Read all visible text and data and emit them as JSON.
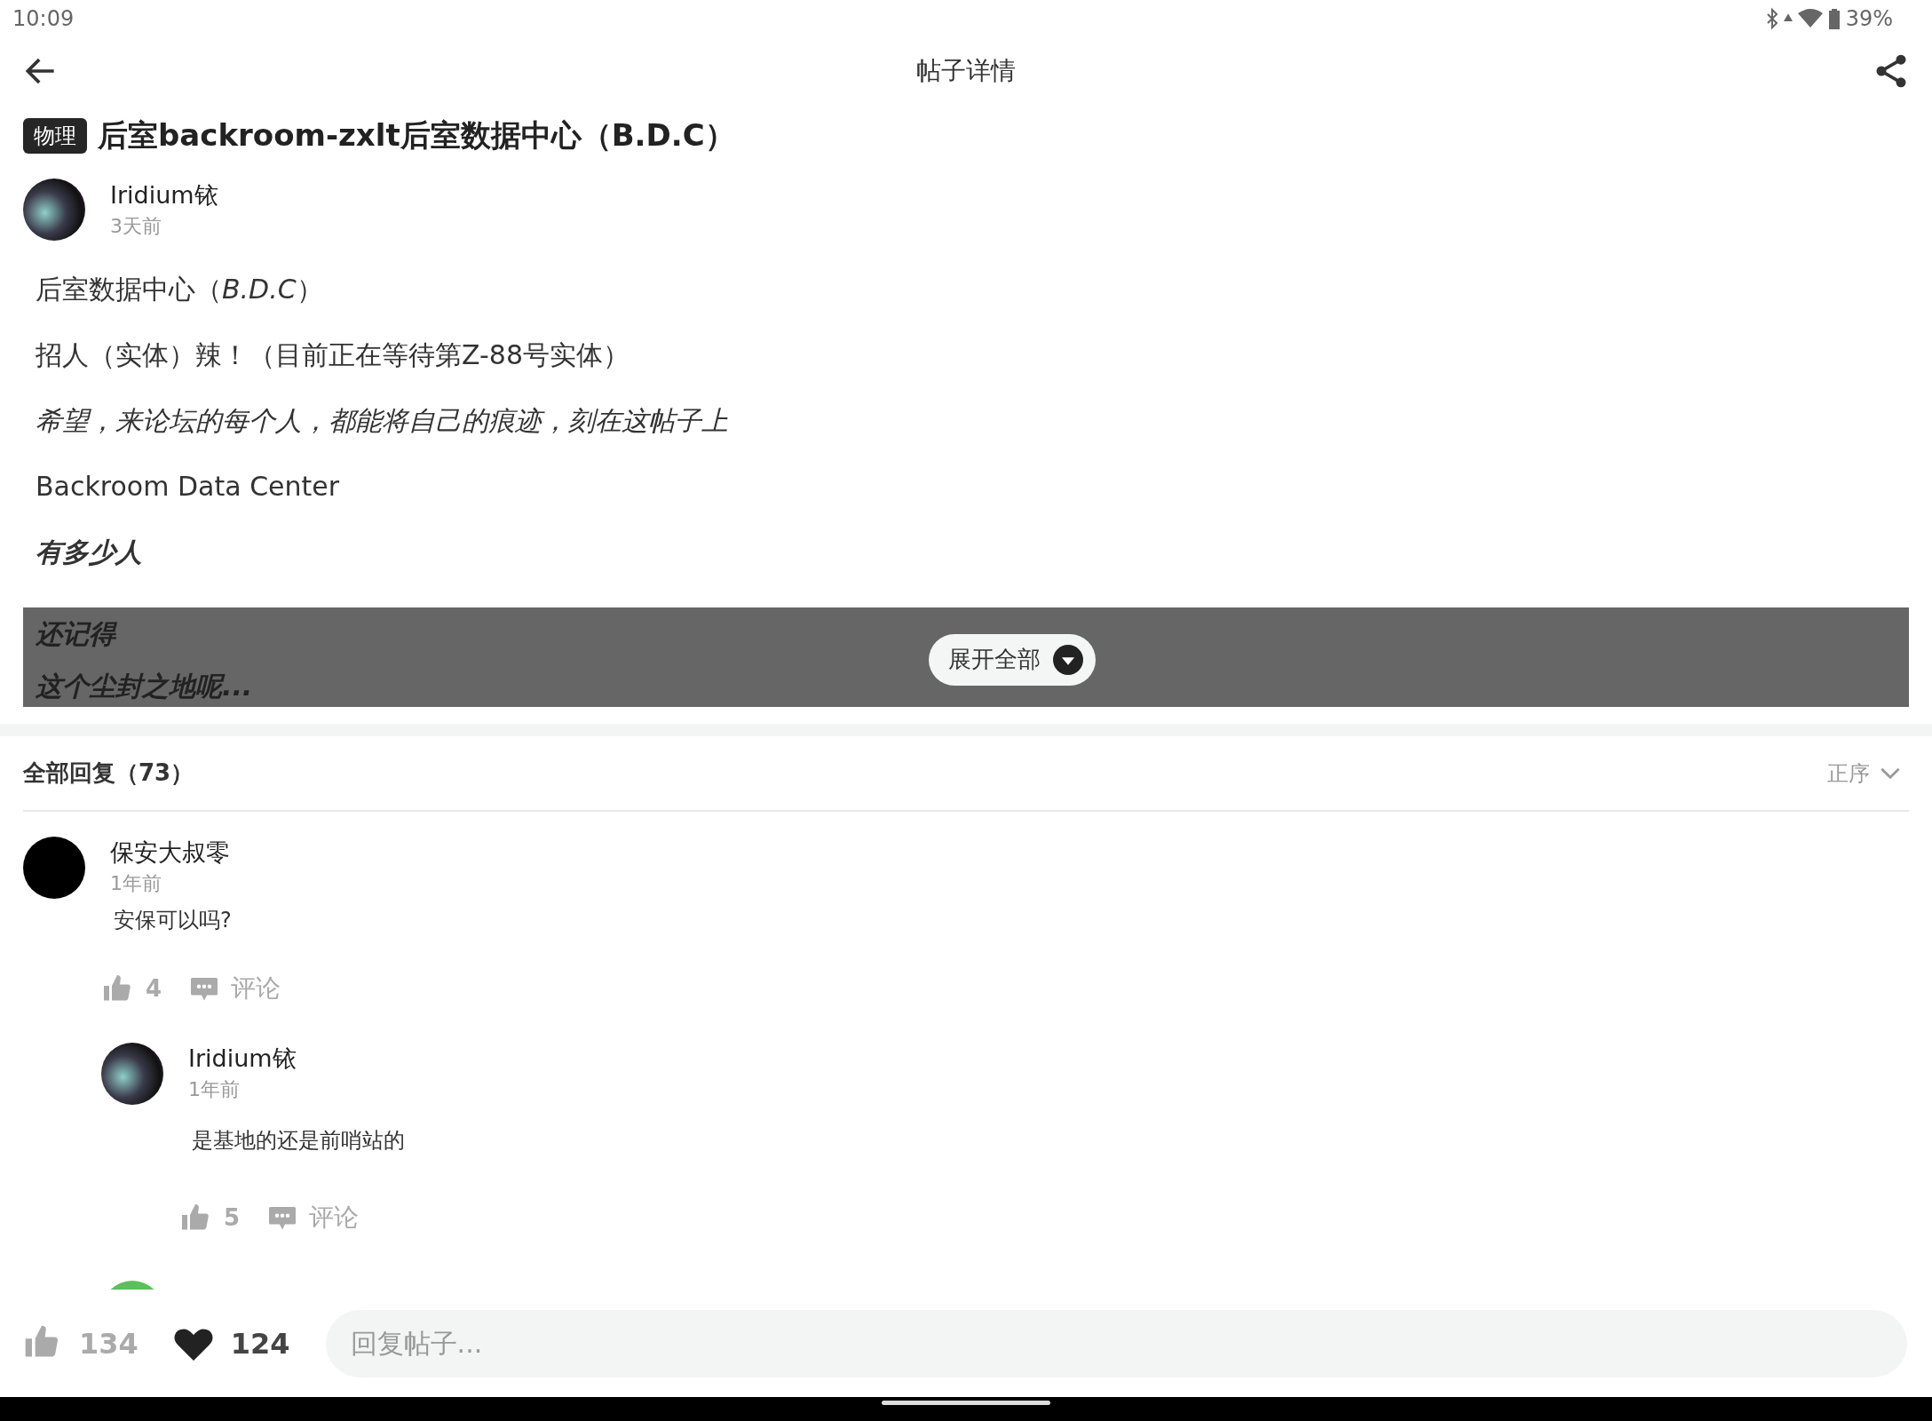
{
  "status_bar": {
    "time": "10:09",
    "battery": "39%"
  },
  "app_bar": {
    "title": "帖子详情"
  },
  "post": {
    "tag": "物理",
    "title": "后室backroom-zxlt后室数据中心（B.D.C）",
    "author": "Iridium铱",
    "time": "3天前",
    "lines": [
      {
        "kind": "plain",
        "text": "后室数据中心（*B.D.C*）"
      },
      {
        "kind": "plain",
        "text": "招人（实体）辣！（目前正在等待第Z-88号实体）"
      },
      {
        "kind": "italic",
        "text": "希望，来论坛的每个人，都能将自己的痕迹，刻在这帖子上"
      },
      {
        "kind": "plain",
        "text": "Backroom Data Center"
      },
      {
        "kind": "bold_italic",
        "text": "有多少人"
      }
    ],
    "collapsed_lines": [
      {
        "kind": "bold_italic",
        "text": "还记得"
      },
      {
        "kind": "bold_italic",
        "text": "这个尘封之地呢..."
      }
    ],
    "expand_label": "展开全部"
  },
  "replies_header": {
    "title": "全部回复（73）",
    "sort": "正序"
  },
  "comments": [
    {
      "author": "保安大叔零",
      "time": "1年前",
      "text": "安保可以吗?",
      "likes": "4",
      "comment_label": "评论",
      "replies": [
        {
          "author": "Iridium铱",
          "time": "1年前",
          "text": "是基地的还是前哨站的",
          "likes": "5",
          "comment_label": "评论"
        }
      ]
    }
  ],
  "bottom_bar": {
    "likes": "134",
    "liked": false,
    "favorites": "124",
    "favorited": true,
    "placeholder": "回复帖子..."
  }
}
